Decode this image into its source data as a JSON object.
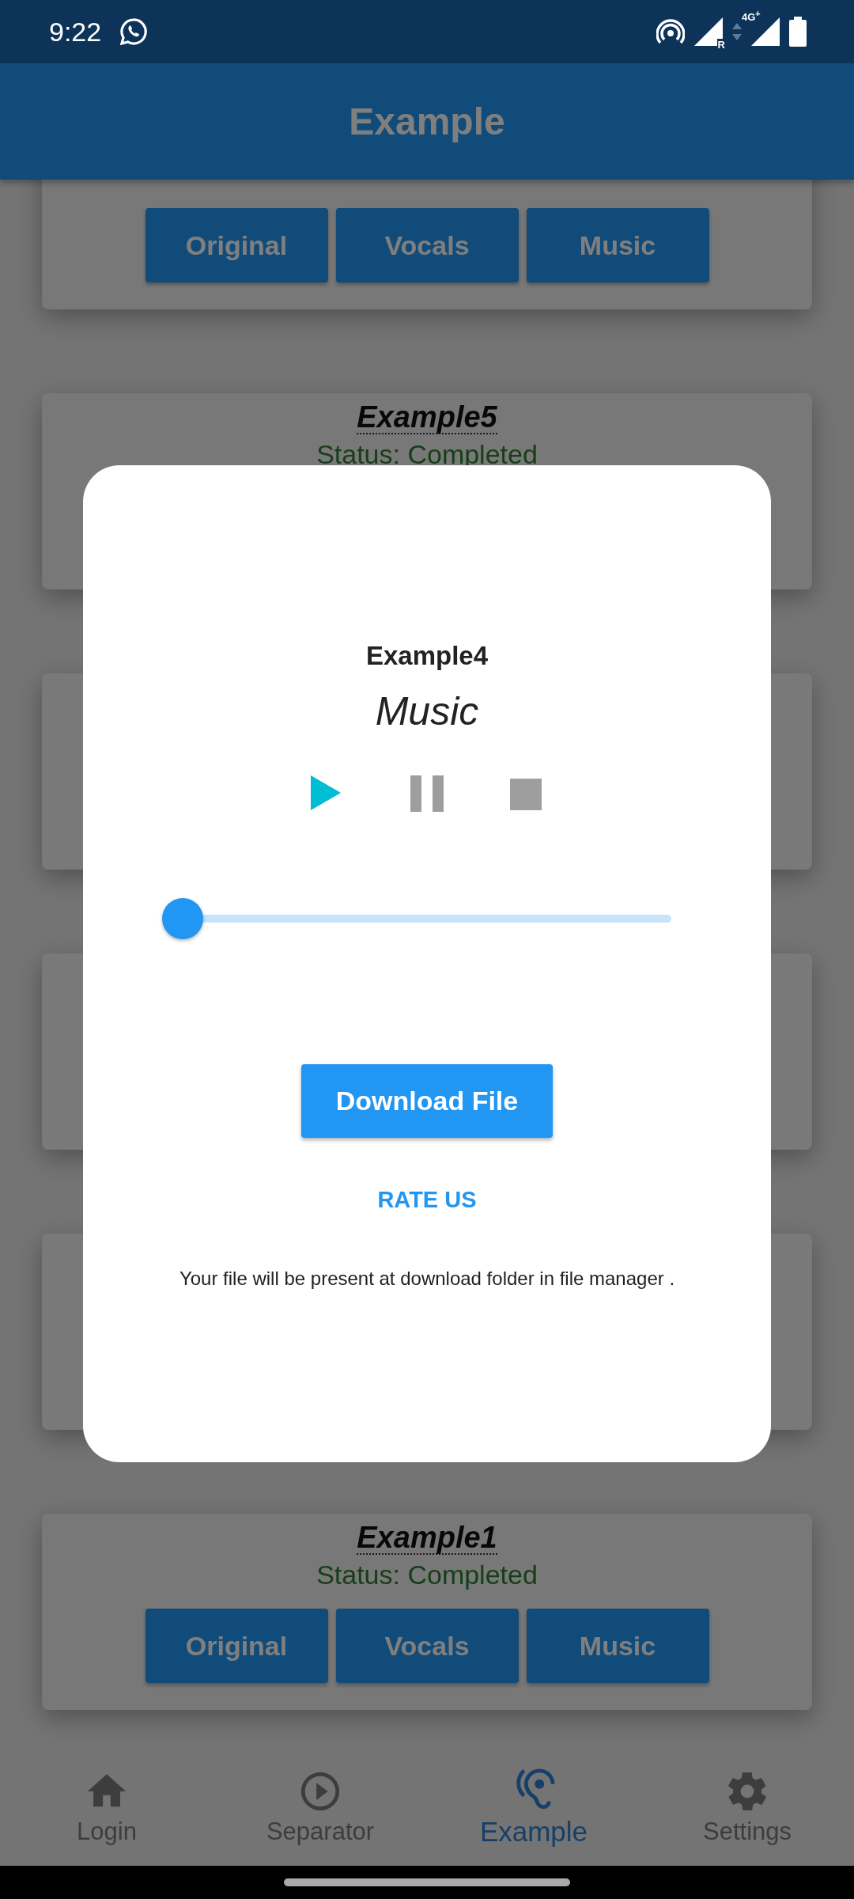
{
  "status_bar": {
    "time": "9:22",
    "sim_labels": [
      "R",
      "4G$^{+}$"
    ]
  },
  "app_bar": {
    "title": "Example"
  },
  "cards": [
    {
      "kind": "card",
      "buttons": [
        "Original",
        "Vocals",
        "Music"
      ]
    },
    {
      "kind": "card",
      "title": "Example5",
      "status": "Status: Completed"
    },
    {
      "kind": "blank"
    },
    {
      "kind": "blank"
    },
    {
      "kind": "blank"
    },
    {
      "kind": "card",
      "title": "Example1",
      "status": "Status: Completed",
      "buttons": [
        "Original",
        "Vocals",
        "Music"
      ]
    }
  ],
  "dialog": {
    "title": "Example4",
    "track": "Music",
    "controls": [
      {
        "kind": "play",
        "enabled": true
      },
      {
        "kind": "pause",
        "enabled": false
      },
      {
        "kind": "stop",
        "enabled": false
      }
    ],
    "slider": {
      "level": 0
    },
    "download_button": "Download File",
    "rate_link": "RATE US",
    "note": "Your file will be present at download folder in file manager ."
  },
  "bottom_nav": [
    {
      "label": "Login",
      "kind": "home",
      "selected": false
    },
    {
      "label": "Separator",
      "kind": "play",
      "selected": false
    },
    {
      "label": "Example",
      "kind": "ear",
      "selected": true
    },
    {
      "label": "Settings",
      "kind": "gear",
      "selected": false
    }
  ]
}
